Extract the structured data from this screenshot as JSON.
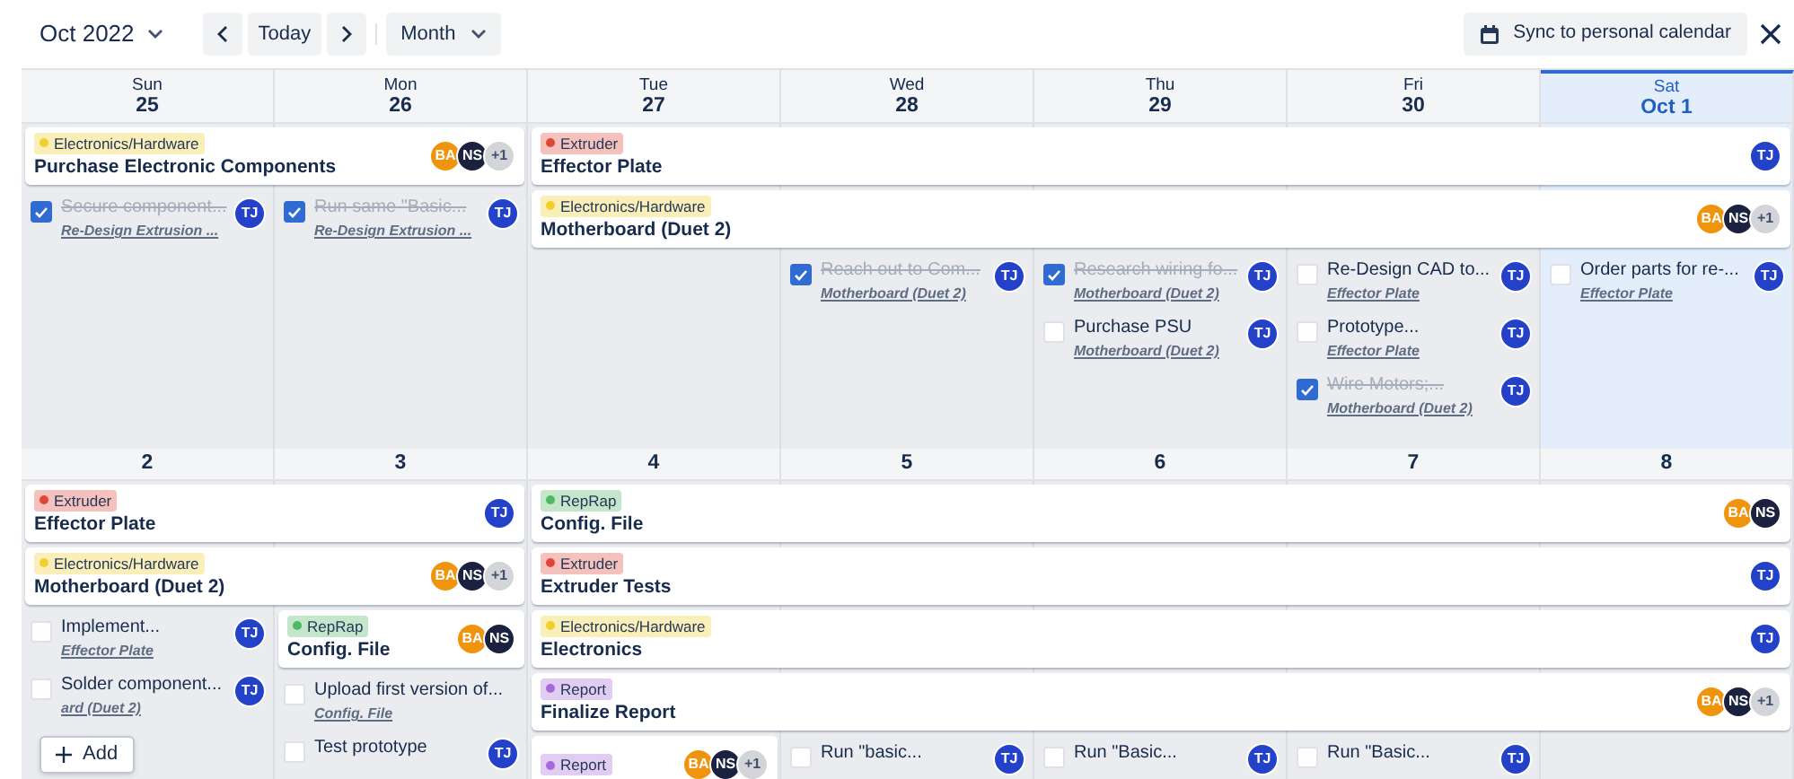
{
  "toolbar": {
    "month": "Oct 2022",
    "today": "Today",
    "view": "Month",
    "sync": "Sync to personal calendar"
  },
  "weeks": [
    {
      "days": [
        {
          "weekday": "Sun",
          "date": "25",
          "today": false,
          "tasks": [
            {
              "title": "Secure component...",
              "link": "Re-Design Extrusion ...",
              "done": true,
              "avatar": {
                "initials": "TJ",
                "color": "#2442c9"
              }
            }
          ]
        },
        {
          "weekday": "Mon",
          "date": "26",
          "today": false,
          "tasks": [
            {
              "title": "Run same \"Basic...",
              "link": "Re-Design Extrusion ...",
              "done": true,
              "avatar": {
                "initials": "TJ",
                "color": "#2442c9"
              }
            }
          ]
        },
        {
          "weekday": "Tue",
          "date": "27",
          "today": false
        },
        {
          "weekday": "Wed",
          "date": "28",
          "today": false,
          "tasks": [
            {
              "title": "Reach out to Com...",
              "link": "Motherboard (Duet 2)",
              "done": true,
              "avatar": {
                "initials": "TJ",
                "color": "#2442c9"
              }
            }
          ]
        },
        {
          "weekday": "Thu",
          "date": "29",
          "today": false,
          "tasks": [
            {
              "title": "Research wiring fo...",
              "link": "Motherboard (Duet 2)",
              "done": true,
              "avatar": {
                "initials": "TJ",
                "color": "#2442c9"
              }
            },
            {
              "title": "Purchase PSU",
              "link": "Motherboard (Duet 2)",
              "done": false,
              "avatar": {
                "initials": "TJ",
                "color": "#2442c9"
              }
            }
          ]
        },
        {
          "weekday": "Fri",
          "date": "30",
          "today": false,
          "tasks": [
            {
              "title": "Re-Design CAD to...",
              "link": "Effector Plate",
              "done": false,
              "avatar": {
                "initials": "TJ",
                "color": "#2442c9"
              }
            },
            {
              "title": "Prototype...",
              "link": "Effector Plate",
              "done": false,
              "avatar": {
                "initials": "TJ",
                "color": "#2442c9"
              }
            },
            {
              "title": "Wire Motors;...",
              "link": "Motherboard (Duet 2)",
              "done": true,
              "avatar": {
                "initials": "TJ",
                "color": "#2442c9"
              }
            }
          ]
        },
        {
          "weekday": "Sat",
          "date": "Oct 1",
          "today": true,
          "tasks": [
            {
              "title": "Order parts for re-...",
              "link": "Effector Plate",
              "done": false,
              "avatar": {
                "initials": "TJ",
                "color": "#2442c9"
              }
            }
          ]
        }
      ],
      "lanes": [
        [
          {
            "kind": "event",
            "tag": {
              "label": "Electronics/Hardware",
              "color": "#f2cf2c"
            },
            "title": "Purchase Electronic Components",
            "avatars": [
              {
                "initials": "BA",
                "color": "#f0930d"
              },
              {
                "initials": "NS",
                "color": "#1b2240"
              },
              {
                "initials": "+1",
                "color": "#d4d5d8"
              }
            ]
          },
          {
            "kind": "continued"
          },
          {
            "kind": "event",
            "tag": {
              "label": "Extruder",
              "color": "#e0453a"
            },
            "title": "Effector Plate",
            "avatars": [
              {
                "initials": "TJ",
                "color": "#2442c9"
              }
            ]
          },
          {
            "kind": "continued"
          },
          {
            "kind": "continued"
          },
          {
            "kind": "continued"
          },
          {
            "kind": "continued"
          }
        ],
        [
          {
            "kind": "empty"
          },
          {
            "kind": "empty"
          },
          {
            "kind": "event",
            "tag": {
              "label": "Electronics/Hardware",
              "color": "#f2cf2c"
            },
            "title": "Motherboard (Duet 2)",
            "avatars": [
              {
                "initials": "BA",
                "color": "#f0930d"
              },
              {
                "initials": "NS",
                "color": "#1b2240"
              },
              {
                "initials": "+1",
                "color": "#d4d5d8"
              }
            ]
          },
          {
            "kind": "continued"
          },
          {
            "kind": "continued"
          },
          {
            "kind": "continued"
          },
          {
            "kind": "continued"
          }
        ]
      ]
    },
    {
      "days": [
        {
          "date": "2",
          "today": false,
          "tasks": [
            {
              "title": "Implement...",
              "link": "Effector Plate",
              "done": false,
              "avatar": {
                "initials": "TJ",
                "color": "#2442c9"
              }
            },
            {
              "title": "Solder component...",
              "link": "ard (Duet 2)",
              "done": false,
              "avatar": {
                "initials": "TJ",
                "color": "#2442c9"
              }
            }
          ]
        },
        {
          "date": "3",
          "today": false,
          "tasks": [
            {
              "title": "Upload first version of...",
              "link": "Config. File",
              "done": false
            },
            {
              "title": "Test prototype",
              "done": false,
              "avatar": {
                "initials": "TJ",
                "color": "#2442c9"
              }
            }
          ]
        },
        {
          "date": "4",
          "today": false
        },
        {
          "date": "5",
          "today": false,
          "tasks": [
            {
              "title": "Run \"basic...",
              "done": false,
              "avatar": {
                "initials": "TJ",
                "color": "#2442c9"
              }
            }
          ]
        },
        {
          "date": "6",
          "today": false,
          "tasks": [
            {
              "title": "Run \"Basic...",
              "done": false,
              "avatar": {
                "initials": "TJ",
                "color": "#2442c9"
              }
            }
          ]
        },
        {
          "date": "7",
          "today": false,
          "tasks": [
            {
              "title": "Run \"Basic...",
              "done": false,
              "avatar": {
                "initials": "TJ",
                "color": "#2442c9"
              }
            }
          ]
        },
        {
          "date": "8",
          "today": false
        }
      ],
      "lanes": [
        [
          {
            "kind": "event",
            "tag": {
              "label": "Extruder",
              "color": "#e0453a"
            },
            "title": "Effector Plate",
            "avatars": [
              {
                "initials": "TJ",
                "color": "#2442c9"
              }
            ]
          },
          {
            "kind": "continued"
          },
          {
            "kind": "event",
            "tag": {
              "label": "RepRap",
              "color": "#4fb862"
            },
            "title": "Config. File",
            "avatars": [
              {
                "initials": "BA",
                "color": "#f0930d"
              },
              {
                "initials": "NS",
                "color": "#1b2240"
              }
            ]
          },
          {
            "kind": "continued"
          },
          {
            "kind": "continued"
          },
          {
            "kind": "continued"
          },
          {
            "kind": "continued"
          }
        ],
        [
          {
            "kind": "event",
            "tag": {
              "label": "Electronics/Hardware",
              "color": "#f2cf2c"
            },
            "title": "Motherboard (Duet 2)",
            "avatars": [
              {
                "initials": "BA",
                "color": "#f0930d"
              },
              {
                "initials": "NS",
                "color": "#1b2240"
              },
              {
                "initials": "+1",
                "color": "#d4d5d8"
              }
            ]
          },
          {
            "kind": "continued"
          },
          {
            "kind": "event",
            "tag": {
              "label": "Extruder",
              "color": "#e0453a"
            },
            "title": "Extruder Tests",
            "avatars": [
              {
                "initials": "TJ",
                "color": "#2442c9"
              }
            ]
          },
          {
            "kind": "continued"
          },
          {
            "kind": "continued"
          },
          {
            "kind": "continued"
          },
          {
            "kind": "continued"
          }
        ],
        [
          {
            "kind": "empty"
          },
          {
            "kind": "event",
            "tag": {
              "label": "RepRap",
              "color": "#4fb862"
            },
            "title": "Config. File",
            "avatars": [
              {
                "initials": "BA",
                "color": "#f0930d"
              },
              {
                "initials": "NS",
                "color": "#1b2240"
              }
            ]
          },
          {
            "kind": "event",
            "tag": {
              "label": "Electronics/Hardware",
              "color": "#f2cf2c"
            },
            "title": "Electronics",
            "avatars": [
              {
                "initials": "TJ",
                "color": "#2442c9"
              }
            ]
          },
          {
            "kind": "continued"
          },
          {
            "kind": "continued"
          },
          {
            "kind": "continued"
          },
          {
            "kind": "continued"
          }
        ],
        [
          {
            "kind": "empty"
          },
          {
            "kind": "empty"
          },
          {
            "kind": "event",
            "tag": {
              "label": "Report",
              "color": "#a66ad8"
            },
            "title": "Finalize Report",
            "avatars": [
              {
                "initials": "BA",
                "color": "#f0930d"
              },
              {
                "initials": "NS",
                "color": "#1b2240"
              },
              {
                "initials": "+1",
                "color": "#d4d5d8"
              }
            ]
          },
          {
            "kind": "continued"
          },
          {
            "kind": "continued"
          },
          {
            "kind": "continued"
          },
          {
            "kind": "continued"
          }
        ],
        [
          {
            "kind": "empty"
          },
          {
            "kind": "empty"
          },
          {
            "kind": "event",
            "tag": {
              "label": "Report",
              "color": "#a66ad8"
            },
            "avatars": [
              {
                "initials": "BA",
                "color": "#f0930d"
              },
              {
                "initials": "NS",
                "color": "#1b2240"
              },
              {
                "initials": "+1",
                "color": "#d4d5d8"
              }
            ]
          },
          {
            "kind": "empty"
          },
          {
            "kind": "empty"
          },
          {
            "kind": "empty"
          },
          {
            "kind": "empty"
          }
        ]
      ]
    }
  ],
  "add_button": {
    "label": "Add"
  }
}
